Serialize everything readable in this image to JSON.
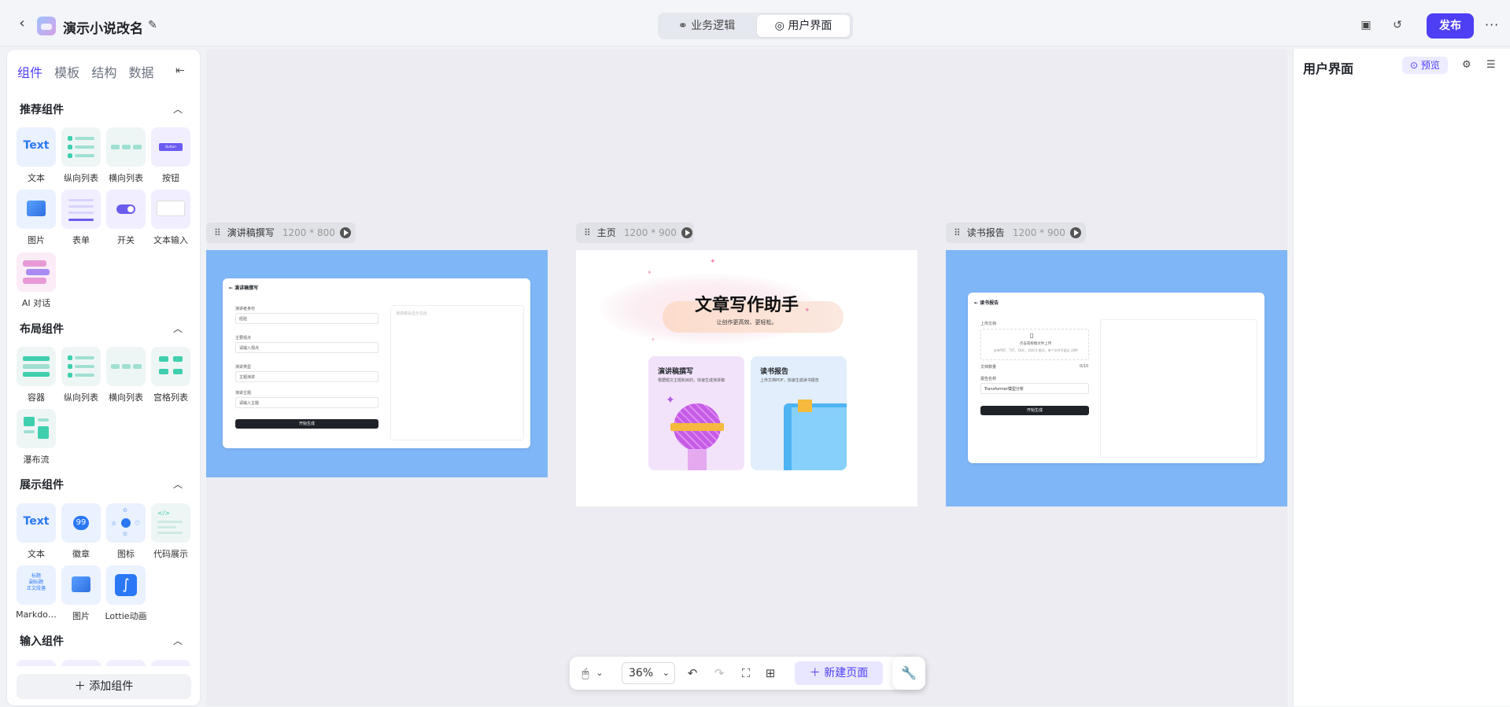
{
  "app": {
    "title": "演示小说改名"
  },
  "header": {
    "segments": [
      "业务逻辑",
      "用户界面"
    ],
    "publish": "发布",
    "more": "···"
  },
  "sidebar": {
    "tabs": [
      "组件",
      "模板",
      "结构",
      "数据"
    ],
    "sections": [
      {
        "title": "推荐组件",
        "items": [
          "文本",
          "纵向列表",
          "横向列表",
          "按钮",
          "图片",
          "表单",
          "开关",
          "文本输入",
          "AI 对话"
        ]
      },
      {
        "title": "布局组件",
        "items": [
          "容器",
          "纵向列表",
          "横向列表",
          "宫格列表",
          "瀑布流"
        ]
      },
      {
        "title": "展示组件",
        "items": [
          "文本",
          "徽章",
          "图标",
          "代码展示",
          "Markdo…",
          "图片",
          "Lottie动画"
        ]
      },
      {
        "title": "输入组件",
        "items": []
      }
    ],
    "thumb_text": "Text",
    "button_thumb": "Button",
    "badge_thumb": "99",
    "markdown_thumb": "标题\n副标题\n正文段落",
    "add_button": "添加组件"
  },
  "canvas": {
    "frames": [
      {
        "name": "演讲稿撰写",
        "size": "1200 * 800"
      },
      {
        "name": "主页",
        "size": "1200 * 900"
      },
      {
        "name": "读书报告",
        "size": "1200 * 900"
      }
    ],
    "speech": {
      "title": "演讲稿撰写",
      "f1": "演讲者身份",
      "f1v": "经验",
      "f2": "主要观点",
      "f2v": "请输入观点",
      "f3": "演讲类型",
      "f3v": "主题演讲",
      "f4": "演讲主题",
      "f4v": "请输入主题",
      "btn": "开始生成",
      "placeholder": "演讲稿会显示在此"
    },
    "home": {
      "title": "文章写作助手",
      "subtitle": "让创作更高效、更轻松。",
      "card1_title": "演讲稿撰写",
      "card1_desc": "根据题文主题和目的，快速生成演讲稿",
      "card2_title": "读书报告",
      "card2_desc": "上传文档PDF，快速生成读书报告"
    },
    "report": {
      "title": "读书报告",
      "upload_label": "上传文档",
      "upload_hint": "点击或拖拽文件上传",
      "upload_sub": "支持PDF、TXT、DOC、DOCX 格式，单个文件不超过 20M",
      "count_label": "文档数量",
      "count": "0/10",
      "name_label": "报告名称",
      "name_value": "Transformer模型分析",
      "btn": "开始生成"
    }
  },
  "toolbar": {
    "zoom": "36%",
    "new_page": "新建页面"
  },
  "right_panel": {
    "title": "用户界面",
    "preview": "预览"
  }
}
